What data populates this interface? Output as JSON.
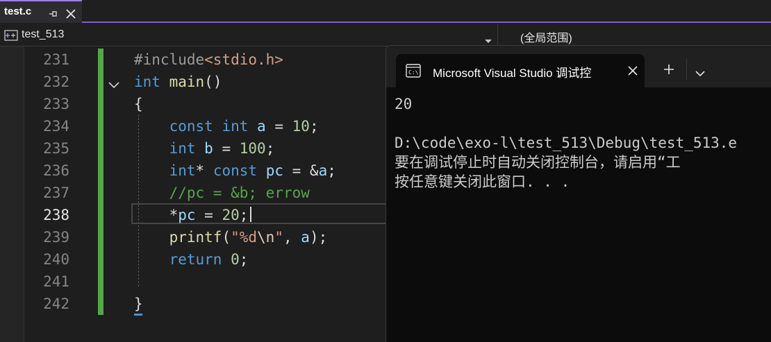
{
  "editor_tab": {
    "label": "test.c",
    "pin_icon": "pin-icon",
    "close_icon": "close-icon"
  },
  "navbar": {
    "project": "test_513",
    "scope": "(全局范围)"
  },
  "code_lines": [
    {
      "number": "231",
      "tokens": [
        {
          "t": "pp",
          "v": "#include"
        },
        {
          "t": "str",
          "v": "<stdio.h>"
        }
      ]
    },
    {
      "number": "232",
      "tokens": [
        {
          "t": "kw",
          "v": "int"
        },
        {
          "t": "pl",
          "v": " "
        },
        {
          "t": "fn",
          "v": "main"
        },
        {
          "t": "pl",
          "v": "()"
        }
      ]
    },
    {
      "number": "233",
      "tokens": [
        {
          "t": "pl",
          "v": "{"
        }
      ]
    },
    {
      "number": "234",
      "tokens": [
        {
          "t": "pl",
          "v": "    "
        },
        {
          "t": "kw",
          "v": "const"
        },
        {
          "t": "pl",
          "v": " "
        },
        {
          "t": "kw",
          "v": "int"
        },
        {
          "t": "pl",
          "v": " "
        },
        {
          "t": "var",
          "v": "a"
        },
        {
          "t": "pl",
          "v": " = "
        },
        {
          "t": "num",
          "v": "10"
        },
        {
          "t": "pl",
          "v": ";"
        }
      ]
    },
    {
      "number": "235",
      "tokens": [
        {
          "t": "pl",
          "v": "    "
        },
        {
          "t": "kw",
          "v": "int"
        },
        {
          "t": "pl",
          "v": " "
        },
        {
          "t": "var",
          "v": "b"
        },
        {
          "t": "pl",
          "v": " = "
        },
        {
          "t": "num",
          "v": "100"
        },
        {
          "t": "pl",
          "v": ";"
        }
      ]
    },
    {
      "number": "236",
      "tokens": [
        {
          "t": "pl",
          "v": "    "
        },
        {
          "t": "kw",
          "v": "int"
        },
        {
          "t": "pl",
          "v": "* "
        },
        {
          "t": "kw",
          "v": "const"
        },
        {
          "t": "pl",
          "v": " "
        },
        {
          "t": "var",
          "v": "pc"
        },
        {
          "t": "pl",
          "v": " = &"
        },
        {
          "t": "var",
          "v": "a"
        },
        {
          "t": "pl",
          "v": ";"
        }
      ]
    },
    {
      "number": "237",
      "tokens": [
        {
          "t": "pl",
          "v": "    "
        },
        {
          "t": "cm",
          "v": "//pc = &b; errow"
        }
      ]
    },
    {
      "number": "238",
      "active": true,
      "tokens": [
        {
          "t": "pl",
          "v": "    *"
        },
        {
          "t": "var",
          "v": "pc"
        },
        {
          "t": "pl",
          "v": " = "
        },
        {
          "t": "num",
          "v": "20"
        },
        {
          "t": "pl",
          "v": ";"
        }
      ]
    },
    {
      "number": "239",
      "tokens": [
        {
          "t": "pl",
          "v": "    "
        },
        {
          "t": "fn",
          "v": "printf"
        },
        {
          "t": "pl",
          "v": "("
        },
        {
          "t": "str",
          "v": "\"%d"
        },
        {
          "t": "esc",
          "v": "\\n"
        },
        {
          "t": "str",
          "v": "\""
        },
        {
          "t": "pl",
          "v": ", "
        },
        {
          "t": "var",
          "v": "a"
        },
        {
          "t": "pl",
          "v": ");"
        }
      ]
    },
    {
      "number": "240",
      "tokens": [
        {
          "t": "pl",
          "v": "    "
        },
        {
          "t": "kw",
          "v": "return"
        },
        {
          "t": "pl",
          "v": " "
        },
        {
          "t": "num",
          "v": "0"
        },
        {
          "t": "pl",
          "v": ";"
        }
      ]
    },
    {
      "number": "241",
      "tokens": []
    },
    {
      "number": "242",
      "tokens": [
        {
          "t": "pl",
          "v": "}"
        }
      ]
    }
  ],
  "console": {
    "tab_title": "Microsoft Visual Studio 调试控",
    "tab_icon": "terminal-icon",
    "new_tab_label": "+",
    "lines": [
      "20",
      "",
      "D:\\code\\exo-l\\test_513\\Debug\\test_513.e",
      "要在调试停止时自动关闭控制台，请启用“工",
      "按任意键关闭此窗口. . ."
    ]
  },
  "colors": {
    "accent": "#7f5fd0",
    "keyword": "#569cd6",
    "function": "#dcdcaa",
    "string": "#d69d85",
    "comment": "#57a64a",
    "number": "#b5cea8",
    "variable": "#9cdcfe",
    "change_bar": "#57a64a"
  }
}
